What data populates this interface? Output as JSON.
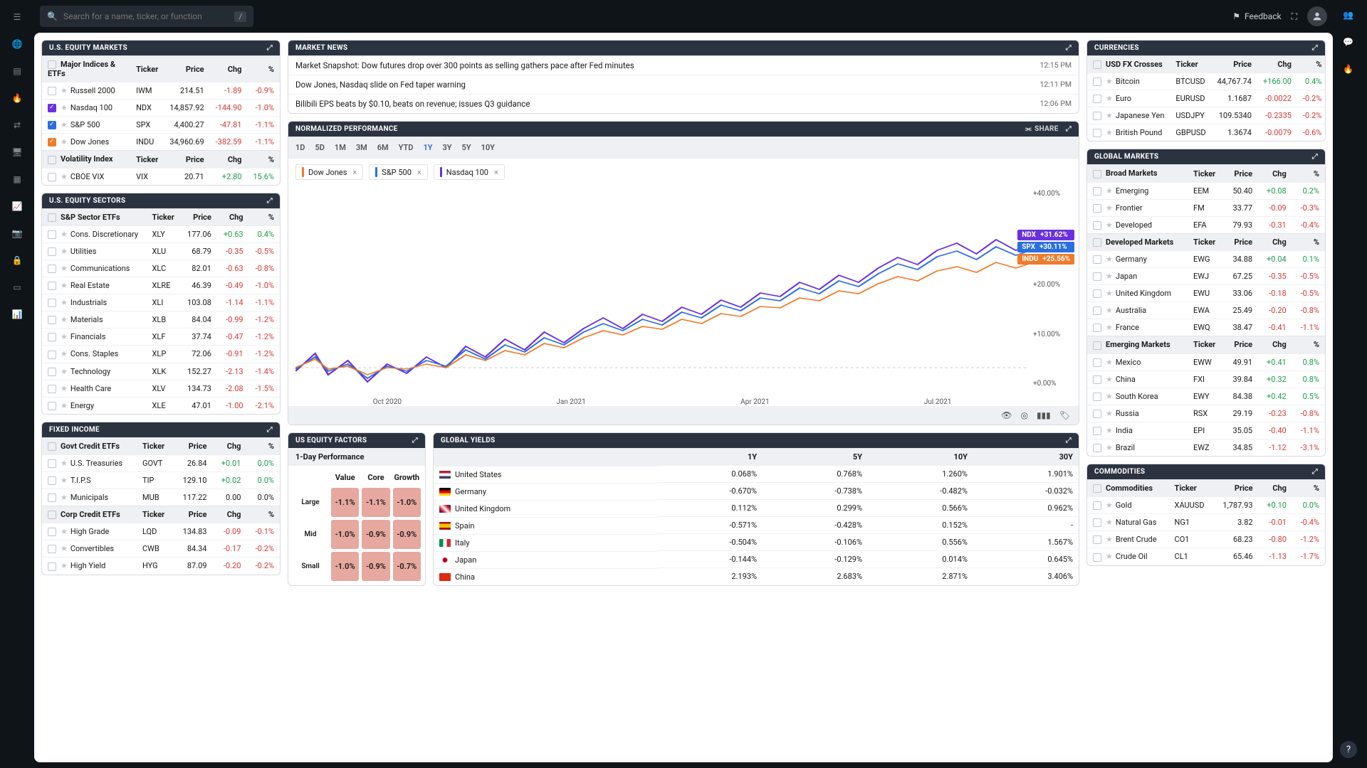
{
  "search": {
    "placeholder": "Search for a name, ticker, or function",
    "kbd": "/"
  },
  "topbar": {
    "feedback": "Feedback"
  },
  "panels": {
    "equity": {
      "title": "U.S. EQUITY MARKETS"
    },
    "sectors": {
      "title": "U.S. EQUITY SECTORS"
    },
    "fixed": {
      "title": "FIXED INCOME"
    },
    "news": {
      "title": "MARKET NEWS"
    },
    "perf": {
      "title": "NORMALIZED PERFORMANCE",
      "share": "SHARE"
    },
    "factors": {
      "title": "US EQUITY FACTORS",
      "sub": "1-Day Performance"
    },
    "yields": {
      "title": "GLOBAL YIELDS"
    },
    "currencies": {
      "title": "CURRENCIES"
    },
    "global": {
      "title": "GLOBAL MARKETS"
    },
    "commodities": {
      "title": "COMMODITIES"
    }
  },
  "headers": {
    "major": "Major Indices & ETFs",
    "vol": "Volatility Index",
    "sectors": "S&P Sector ETFs",
    "govt": "Govt Credit ETFs",
    "corp": "Corp Credit ETFs",
    "fx": "USD FX Crosses",
    "broad": "Broad Markets",
    "dev": "Developed Markets",
    "emg": "Emerging Markets",
    "comm": "Commodities",
    "ticker": "Ticker",
    "price": "Price",
    "chg": "Chg",
    "pct": "%"
  },
  "equity_major": [
    {
      "name": "Russell 2000",
      "ticker": "IWM",
      "price": "214.51",
      "chg": "-1.89",
      "pct": "-0.9%",
      "checked": false
    },
    {
      "name": "Nasdaq 100",
      "ticker": "NDX",
      "price": "14,857.92",
      "chg": "-144.90",
      "pct": "-1.0%",
      "checked": true,
      "color": "#6a2fe0"
    },
    {
      "name": "S&P 500",
      "ticker": "SPX",
      "price": "4,400.27",
      "chg": "-47.81",
      "pct": "-1.1%",
      "checked": true,
      "color": "#2a6fe0"
    },
    {
      "name": "Dow Jones",
      "ticker": "INDU",
      "price": "34,960.69",
      "chg": "-382.59",
      "pct": "-1.1%",
      "checked": true,
      "color": "#f07b2c"
    }
  ],
  "equity_vol": [
    {
      "name": "CBOE VIX",
      "ticker": "VIX",
      "price": "20.71",
      "chg": "+2.80",
      "pct": "15.6%",
      "pos": true
    }
  ],
  "sectors": [
    {
      "name": "Cons. Discretionary",
      "ticker": "XLY",
      "price": "177.06",
      "chg": "+0.63",
      "pct": "0.4%",
      "pos": true
    },
    {
      "name": "Utilities",
      "ticker": "XLU",
      "price": "68.79",
      "chg": "-0.35",
      "pct": "-0.5%"
    },
    {
      "name": "Communications",
      "ticker": "XLC",
      "price": "82.01",
      "chg": "-0.63",
      "pct": "-0.8%"
    },
    {
      "name": "Real Estate",
      "ticker": "XLRE",
      "price": "46.39",
      "chg": "-0.49",
      "pct": "-1.0%"
    },
    {
      "name": "Industrials",
      "ticker": "XLI",
      "price": "103.08",
      "chg": "-1.14",
      "pct": "-1.1%"
    },
    {
      "name": "Materials",
      "ticker": "XLB",
      "price": "84.04",
      "chg": "-0.99",
      "pct": "-1.2%"
    },
    {
      "name": "Financials",
      "ticker": "XLF",
      "price": "37.74",
      "chg": "-0.47",
      "pct": "-1.2%"
    },
    {
      "name": "Cons. Staples",
      "ticker": "XLP",
      "price": "72.06",
      "chg": "-0.91",
      "pct": "-1.2%"
    },
    {
      "name": "Technology",
      "ticker": "XLK",
      "price": "152.27",
      "chg": "-2.13",
      "pct": "-1.4%"
    },
    {
      "name": "Health Care",
      "ticker": "XLV",
      "price": "134.73",
      "chg": "-2.08",
      "pct": "-1.5%"
    },
    {
      "name": "Energy",
      "ticker": "XLE",
      "price": "47.01",
      "chg": "-1.00",
      "pct": "-2.1%"
    }
  ],
  "fixed_govt": [
    {
      "name": "U.S. Treasuries",
      "ticker": "GOVT",
      "price": "26.84",
      "chg": "+0.01",
      "pct": "0.0%",
      "pos": true
    },
    {
      "name": "T.I.P.S",
      "ticker": "TIP",
      "price": "129.10",
      "chg": "+0.02",
      "pct": "0.0%",
      "pos": true
    },
    {
      "name": "Municipals",
      "ticker": "MUB",
      "price": "117.22",
      "chg": "0.00",
      "pct": "0.0%",
      "neutral": true
    }
  ],
  "fixed_corp": [
    {
      "name": "High Grade",
      "ticker": "LQD",
      "price": "134.83",
      "chg": "-0.09",
      "pct": "-0.1%"
    },
    {
      "name": "Convertibles",
      "ticker": "CWB",
      "price": "84.34",
      "chg": "-0.17",
      "pct": "-0.2%"
    },
    {
      "name": "High Yield",
      "ticker": "HYG",
      "price": "87.09",
      "chg": "-0.20",
      "pct": "-0.2%"
    }
  ],
  "news": [
    {
      "headline": "Market Snapshot: Dow futures drop over 300 points as selling gathers pace after Fed minutes",
      "time": "12:15 PM"
    },
    {
      "headline": "Dow Jones, Nasdaq slide on Fed taper warning",
      "time": "12:11 PM"
    },
    {
      "headline": "Bilibili EPS beats by $0.10, beats on revenue; issues Q3 guidance",
      "time": "12:06 PM"
    }
  ],
  "ranges": [
    "1D",
    "5D",
    "1M",
    "3M",
    "6M",
    "YTD",
    "1Y",
    "3Y",
    "5Y",
    "10Y"
  ],
  "range_active": "1Y",
  "chips": [
    {
      "label": "Dow Jones",
      "color": "#f07b2c"
    },
    {
      "label": "S&P 500",
      "color": "#2a6fe0"
    },
    {
      "label": "Nasdaq 100",
      "color": "#6a2fe0"
    }
  ],
  "chart_badges": [
    {
      "label": "NDX",
      "val": "+31.62%",
      "color": "#6a2fe0"
    },
    {
      "label": "SPX",
      "val": "+30.11%",
      "color": "#2a6fe0"
    },
    {
      "label": "INDU",
      "val": "+25.56%",
      "color": "#f07b2c"
    }
  ],
  "chart_x": [
    "Oct 2020",
    "Jan 2021",
    "Apr 2021",
    "Jul 2021"
  ],
  "chart_y": [
    "+40.00%",
    "",
    "+20.00%",
    "+10.00%",
    "+0.00%"
  ],
  "chart_data": {
    "type": "line",
    "xlabel": "",
    "ylabel": "",
    "x_categories": [
      "Oct 2020",
      "Jan 2021",
      "Apr 2021",
      "Jul 2021"
    ],
    "ylim": [
      -5,
      40
    ],
    "series": [
      {
        "name": "NDX",
        "color": "#6a2fe0",
        "final": 31.62
      },
      {
        "name": "SPX",
        "color": "#2a6fe0",
        "final": 30.11
      },
      {
        "name": "INDU",
        "color": "#f07b2c",
        "final": 25.56
      }
    ],
    "note": "Normalized cumulative % return over 1Y; all series start near 0%, dip ~-3% in Oct 2020, and trend upward to final values shown in badges."
  },
  "factors": {
    "cols": [
      "Value",
      "Core",
      "Growth"
    ],
    "rows": [
      "Large",
      "Mid",
      "Small"
    ],
    "cells": [
      [
        "-1.1%",
        "-1.1%",
        "-1.0%"
      ],
      [
        "-1.0%",
        "-0.9%",
        "-0.9%"
      ],
      [
        "-1.0%",
        "-0.9%",
        "-0.7%"
      ]
    ]
  },
  "yields": {
    "cols": [
      "1Y",
      "5Y",
      "10Y",
      "30Y"
    ],
    "rows": [
      {
        "country": "United States",
        "flag": "linear-gradient(#b22234 33%,#fff 33% 66%,#3c3b6e 66%)",
        "v": [
          "0.068%",
          "0.768%",
          "1.260%",
          "1.901%"
        ]
      },
      {
        "country": "Germany",
        "flag": "linear-gradient(#000 33%,#dd0000 33% 66%,#ffce00 66%)",
        "v": [
          "-0.670%",
          "-0.738%",
          "-0.482%",
          "-0.032%"
        ]
      },
      {
        "country": "United Kingdom",
        "flag": "linear-gradient(45deg,#00247d,#cf142b,#fff,#cf142b,#00247d)",
        "v": [
          "0.112%",
          "0.299%",
          "0.566%",
          "0.962%"
        ]
      },
      {
        "country": "Spain",
        "flag": "linear-gradient(#aa151b 25%,#f1bf00 25% 75%,#aa151b 75%)",
        "v": [
          "-0.571%",
          "-0.428%",
          "0.152%",
          "-"
        ]
      },
      {
        "country": "Italy",
        "flag": "linear-gradient(90deg,#009246 33%,#fff 33% 66%,#ce2b37 66%)",
        "v": [
          "-0.504%",
          "-0.106%",
          "0.556%",
          "1.567%"
        ]
      },
      {
        "country": "Japan",
        "flag": "radial-gradient(circle,#bc002d 35%,#fff 36%)",
        "v": [
          "-0.144%",
          "-0.129%",
          "0.014%",
          "0.645%"
        ]
      },
      {
        "country": "China",
        "flag": "linear-gradient(#de2910,#de2910)",
        "v": [
          "2.193%",
          "2.683%",
          "2.871%",
          "3.406%"
        ]
      }
    ]
  },
  "currencies": [
    {
      "name": "Bitcoin",
      "ticker": "BTCUSD",
      "price": "44,767.74",
      "chg": "+166.00",
      "pct": "0.4%",
      "pos": true
    },
    {
      "name": "Euro",
      "ticker": "EURUSD",
      "price": "1.1687",
      "chg": "-0.0022",
      "pct": "-0.2%"
    },
    {
      "name": "Japanese Yen",
      "ticker": "USDJPY",
      "price": "109.5340",
      "chg": "-0.2335",
      "pct": "-0.2%"
    },
    {
      "name": "British Pound",
      "ticker": "GBPUSD",
      "price": "1.3674",
      "chg": "-0.0079",
      "pct": "-0.6%"
    }
  ],
  "global_broad": [
    {
      "name": "Emerging",
      "ticker": "EEM",
      "price": "50.40",
      "chg": "+0.08",
      "pct": "0.2%",
      "pos": true
    },
    {
      "name": "Frontier",
      "ticker": "FM",
      "price": "33.77",
      "chg": "-0.09",
      "pct": "-0.3%"
    },
    {
      "name": "Developed",
      "ticker": "EFA",
      "price": "79.93",
      "chg": "-0.31",
      "pct": "-0.4%"
    }
  ],
  "global_dev": [
    {
      "name": "Germany",
      "ticker": "EWG",
      "price": "34.88",
      "chg": "+0.04",
      "pct": "0.1%",
      "pos": true
    },
    {
      "name": "Japan",
      "ticker": "EWJ",
      "price": "67.25",
      "chg": "-0.35",
      "pct": "-0.5%"
    },
    {
      "name": "United Kingdom",
      "ticker": "EWU",
      "price": "33.06",
      "chg": "-0.18",
      "pct": "-0.5%"
    },
    {
      "name": "Australia",
      "ticker": "EWA",
      "price": "25.49",
      "chg": "-0.20",
      "pct": "-0.8%"
    },
    {
      "name": "France",
      "ticker": "EWQ",
      "price": "38.47",
      "chg": "-0.41",
      "pct": "-1.1%"
    }
  ],
  "global_emg": [
    {
      "name": "Mexico",
      "ticker": "EWW",
      "price": "49.91",
      "chg": "+0.41",
      "pct": "0.8%",
      "pos": true
    },
    {
      "name": "China",
      "ticker": "FXI",
      "price": "39.84",
      "chg": "+0.32",
      "pct": "0.8%",
      "pos": true
    },
    {
      "name": "South Korea",
      "ticker": "EWY",
      "price": "84.38",
      "chg": "+0.42",
      "pct": "0.5%",
      "pos": true
    },
    {
      "name": "Russia",
      "ticker": "RSX",
      "price": "29.19",
      "chg": "-0.23",
      "pct": "-0.8%"
    },
    {
      "name": "India",
      "ticker": "EPI",
      "price": "35.05",
      "chg": "-0.40",
      "pct": "-1.1%"
    },
    {
      "name": "Brazil",
      "ticker": "EWZ",
      "price": "34.85",
      "chg": "-1.12",
      "pct": "-3.1%"
    }
  ],
  "commodities": [
    {
      "name": "Gold",
      "ticker": "XAUUSD",
      "price": "1,787.93",
      "chg": "+0.10",
      "pct": "0.0%",
      "pos": true
    },
    {
      "name": "Natural Gas",
      "ticker": "NG1",
      "price": "3.82",
      "chg": "-0.01",
      "pct": "-0.4%"
    },
    {
      "name": "Brent Crude",
      "ticker": "CO1",
      "price": "68.23",
      "chg": "-0.80",
      "pct": "-1.2%"
    },
    {
      "name": "Crude Oil",
      "ticker": "CL1",
      "price": "65.46",
      "chg": "-1.13",
      "pct": "-1.7%"
    }
  ]
}
